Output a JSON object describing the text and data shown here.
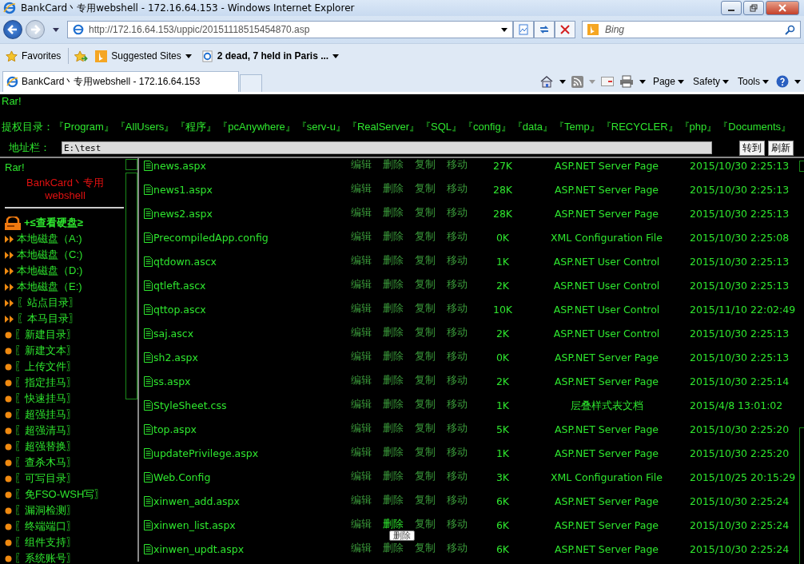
{
  "window": {
    "title": "BankCard丶专用webshell - 172.16.64.153 - Windows Internet Explorer"
  },
  "address_bar": {
    "url": "http://172.16.64.153/uppic/20151118515454870.asp"
  },
  "search": {
    "placeholder": "Bing"
  },
  "favorites_bar": {
    "label": "Favorites",
    "items": [
      "Suggested Sites",
      "2 dead, 7 held in Paris ..."
    ]
  },
  "tabs": [
    {
      "label": "BankCard丶专用webshell - 172.16.64.153",
      "selected": true
    }
  ],
  "command_bar": [
    "Page",
    "Safety",
    "Tools"
  ],
  "page": {
    "banner": "Rar!",
    "shortcut_label": "提权目录：",
    "shortcuts": [
      "『Program』",
      "『AllUsers』",
      "『程序』",
      "『pcAnywhere』",
      "『serv-u』",
      "『RealServer』",
      "『SQL』",
      "『config』",
      "『data』",
      "『Temp』",
      "『RECYCLER』",
      "『php』",
      "『Documents』"
    ],
    "path_label": "地址栏：",
    "path_value": "E:\\test",
    "buttons": [
      "转到",
      "刷新"
    ]
  },
  "sidebar": {
    "title": "Rar!",
    "subtitle": "BankCard丶专用webshell",
    "drive_header": "+≤查看硬盘≥",
    "items": [
      {
        "label": "本地磁盘（A:)",
        "kind": "arrow"
      },
      {
        "label": "本地磁盘（C:)",
        "kind": "arrow"
      },
      {
        "label": "本地磁盘（D:)",
        "kind": "arrow"
      },
      {
        "label": "本地磁盘（E:)",
        "kind": "arrow"
      },
      {
        "label": "〖站点目录〗",
        "kind": "arrow"
      },
      {
        "label": "〖本马目录〗",
        "kind": "arrow"
      },
      {
        "label": "〖新建目录〗",
        "kind": "dot"
      },
      {
        "label": "〖新建文本〗",
        "kind": "dot"
      },
      {
        "label": "〖上传文件〗",
        "kind": "dot"
      },
      {
        "label": "〖指定挂马〗",
        "kind": "dot"
      },
      {
        "label": "〖快速挂马〗",
        "kind": "dot"
      },
      {
        "label": "〖超强挂马〗",
        "kind": "dot"
      },
      {
        "label": "〖超强清马〗",
        "kind": "dot"
      },
      {
        "label": "〖超强替换〗",
        "kind": "dot"
      },
      {
        "label": "〖查杀木马〗",
        "kind": "dot"
      },
      {
        "label": "〖可写目录〗",
        "kind": "dot"
      },
      {
        "label": "〖免FSO-WSH写〗",
        "kind": "dot"
      },
      {
        "label": "〖漏洞检测〗",
        "kind": "dot"
      },
      {
        "label": "〖终端端口〗",
        "kind": "dot"
      },
      {
        "label": "〖组件支持〗",
        "kind": "dot"
      },
      {
        "label": "〖系统账号〗",
        "kind": "dot"
      }
    ]
  },
  "files": [
    {
      "name": "news.aspx",
      "size": "27K",
      "type": "ASP.NET Server Page",
      "modified": "2015/10/30 2:25:13",
      "actions": [
        {
          "label": "编辑",
          "hover": false
        },
        {
          "label": "删除",
          "hover": false
        },
        {
          "label": "复制",
          "hover": false
        },
        {
          "label": "移动",
          "hover": false
        }
      ]
    },
    {
      "name": "news1.aspx",
      "size": "28K",
      "type": "ASP.NET Server Page",
      "modified": "2015/10/30 2:25:13",
      "actions": [
        {
          "label": "编辑",
          "hover": false
        },
        {
          "label": "删除",
          "hover": false
        },
        {
          "label": "复制",
          "hover": false
        },
        {
          "label": "移动",
          "hover": false
        }
      ]
    },
    {
      "name": "news2.aspx",
      "size": "28K",
      "type": "ASP.NET Server Page",
      "modified": "2015/10/30 2:25:13",
      "actions": [
        {
          "label": "编辑",
          "hover": false
        },
        {
          "label": "删除",
          "hover": false
        },
        {
          "label": "复制",
          "hover": false
        },
        {
          "label": "移动",
          "hover": false
        }
      ]
    },
    {
      "name": "PrecompiledApp.config",
      "size": "0K",
      "type": "XML Configuration File",
      "modified": "2015/10/30 2:25:08",
      "actions": [
        {
          "label": "编辑",
          "hover": false
        },
        {
          "label": "删除",
          "hover": false
        },
        {
          "label": "复制",
          "hover": false
        },
        {
          "label": "移动",
          "hover": false
        }
      ]
    },
    {
      "name": "qtdown.ascx",
      "size": "1K",
      "type": "ASP.NET User Control",
      "modified": "2015/10/30 2:25:13",
      "actions": [
        {
          "label": "编辑",
          "hover": false
        },
        {
          "label": "删除",
          "hover": false
        },
        {
          "label": "复制",
          "hover": false
        },
        {
          "label": "移动",
          "hover": false
        }
      ]
    },
    {
      "name": "qtleft.ascx",
      "size": "2K",
      "type": "ASP.NET User Control",
      "modified": "2015/10/30 2:25:13",
      "actions": [
        {
          "label": "编辑",
          "hover": false
        },
        {
          "label": "删除",
          "hover": false
        },
        {
          "label": "复制",
          "hover": false
        },
        {
          "label": "移动",
          "hover": false
        }
      ]
    },
    {
      "name": "qttop.ascx",
      "size": "10K",
      "type": "ASP.NET User Control",
      "modified": "2015/11/10 22:02:49",
      "actions": [
        {
          "label": "编辑",
          "hover": false
        },
        {
          "label": "删除",
          "hover": false
        },
        {
          "label": "复制",
          "hover": false
        },
        {
          "label": "移动",
          "hover": false
        }
      ]
    },
    {
      "name": "saj.ascx",
      "size": "2K",
      "type": "ASP.NET User Control",
      "modified": "2015/10/30 2:25:13",
      "actions": [
        {
          "label": "编辑",
          "hover": false
        },
        {
          "label": "删除",
          "hover": false
        },
        {
          "label": "复制",
          "hover": false
        },
        {
          "label": "移动",
          "hover": false
        }
      ]
    },
    {
      "name": "sh2.aspx",
      "size": "0K",
      "type": "ASP.NET Server Page",
      "modified": "2015/10/30 2:25:13",
      "actions": [
        {
          "label": "编辑",
          "hover": false
        },
        {
          "label": "删除",
          "hover": false
        },
        {
          "label": "复制",
          "hover": false
        },
        {
          "label": "移动",
          "hover": false
        }
      ]
    },
    {
      "name": "ss.aspx",
      "size": "2K",
      "type": "ASP.NET Server Page",
      "modified": "2015/10/30 2:25:14",
      "actions": [
        {
          "label": "编辑",
          "hover": false
        },
        {
          "label": "删除",
          "hover": false
        },
        {
          "label": "复制",
          "hover": false
        },
        {
          "label": "移动",
          "hover": false
        }
      ]
    },
    {
      "name": "StyleSheet.css",
      "size": "1K",
      "type": "层叠样式表文档",
      "modified": "2015/4/8 13:01:02",
      "actions": [
        {
          "label": "编辑",
          "hover": false
        },
        {
          "label": "删除",
          "hover": false
        },
        {
          "label": "复制",
          "hover": false
        },
        {
          "label": "移动",
          "hover": false
        }
      ]
    },
    {
      "name": "top.aspx",
      "size": "5K",
      "type": "ASP.NET Server Page",
      "modified": "2015/10/30 2:25:20",
      "actions": [
        {
          "label": "编辑",
          "hover": false
        },
        {
          "label": "删除",
          "hover": false
        },
        {
          "label": "复制",
          "hover": false
        },
        {
          "label": "移动",
          "hover": false
        }
      ]
    },
    {
      "name": "updatePrivilege.aspx",
      "size": "1K",
      "type": "ASP.NET Server Page",
      "modified": "2015/10/30 2:25:20",
      "actions": [
        {
          "label": "编辑",
          "hover": false
        },
        {
          "label": "删除",
          "hover": false
        },
        {
          "label": "复制",
          "hover": false
        },
        {
          "label": "移动",
          "hover": false
        }
      ]
    },
    {
      "name": "Web.Config",
      "size": "3K",
      "type": "XML Configuration File",
      "modified": "2015/10/25 20:15:29",
      "actions": [
        {
          "label": "编辑",
          "hover": false
        },
        {
          "label": "删除",
          "hover": false
        },
        {
          "label": "复制",
          "hover": false
        },
        {
          "label": "移动",
          "hover": false
        }
      ]
    },
    {
      "name": "xinwen_add.aspx",
      "size": "6K",
      "type": "ASP.NET Server Page",
      "modified": "2015/10/30 2:25:24",
      "actions": [
        {
          "label": "编辑",
          "hover": false
        },
        {
          "label": "删除",
          "hover": false
        },
        {
          "label": "复制",
          "hover": false
        },
        {
          "label": "移动",
          "hover": false
        }
      ]
    },
    {
      "name": "xinwen_list.aspx",
      "size": "6K",
      "type": "ASP.NET Server Page",
      "modified": "2015/10/30 2:25:24",
      "actions": [
        {
          "label": "编辑",
          "hover": false
        },
        {
          "label": "删除",
          "hover": true
        },
        {
          "label": "复制",
          "hover": false
        },
        {
          "label": "移动",
          "hover": false
        }
      ]
    },
    {
      "name": "xinwen_updt.aspx",
      "size": "6K",
      "type": "ASP.NET Server Page",
      "modified": "2015/10/30 2:25:24",
      "actions": [
        {
          "label": "编辑",
          "hover": false
        },
        {
          "label": "删除",
          "hover": false
        },
        {
          "label": "复制",
          "hover": false
        },
        {
          "label": "移动",
          "hover": false
        }
      ]
    }
  ],
  "tooltip": "删除"
}
